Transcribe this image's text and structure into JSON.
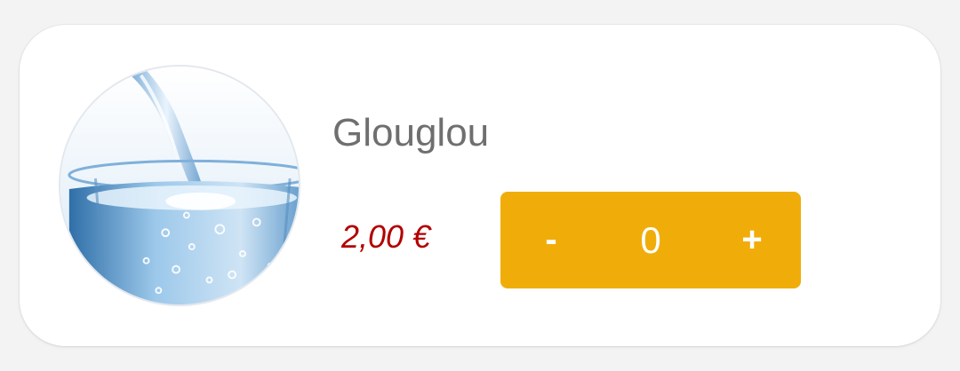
{
  "product": {
    "name": "Glouglou",
    "price": "2,00 €",
    "image_alt": "glass of water"
  },
  "stepper": {
    "decrement_label": "-",
    "quantity": "0",
    "increment_label": "+"
  },
  "colors": {
    "accent": "#f0ad0a",
    "price": "#b30000",
    "name": "#6f6f6f",
    "card": "#ffffff"
  }
}
